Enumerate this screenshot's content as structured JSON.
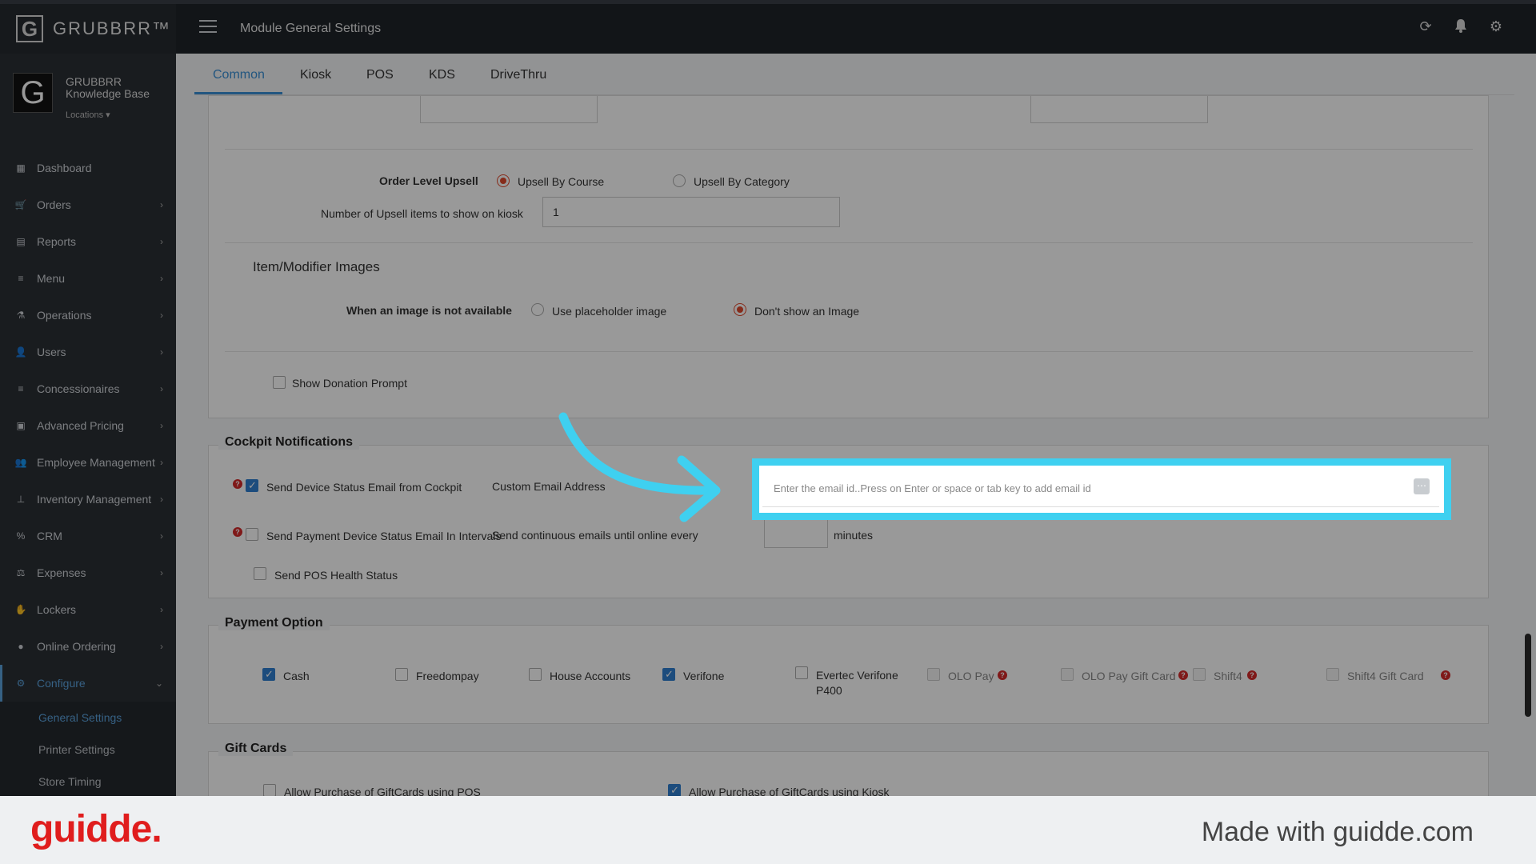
{
  "app": {
    "brand": "GRUBBRR™",
    "logo_letter": "G",
    "page_title": "Module General Settings"
  },
  "topbar_icons": [
    "refresh-icon",
    "bell-icon",
    "gear-icon"
  ],
  "profile": {
    "name": "GRUBBRR Knowledge Base",
    "locations_label": "Locations"
  },
  "sidebar": {
    "items": [
      {
        "label": "Dashboard",
        "icon": "dashboard-icon"
      },
      {
        "label": "Orders",
        "icon": "cart-icon"
      },
      {
        "label": "Reports",
        "icon": "report-icon"
      },
      {
        "label": "Menu",
        "icon": "list-icon"
      },
      {
        "label": "Operations",
        "icon": "flask-icon"
      },
      {
        "label": "Users",
        "icon": "user-add-icon"
      },
      {
        "label": "Concessionaires",
        "icon": "list-icon"
      },
      {
        "label": "Advanced Pricing",
        "icon": "money-icon"
      },
      {
        "label": "Employee Management",
        "icon": "users-icon"
      },
      {
        "label": "Inventory Management",
        "icon": "sitemap-icon"
      },
      {
        "label": "CRM",
        "icon": "percent-icon"
      },
      {
        "label": "Expenses",
        "icon": "scale-icon"
      },
      {
        "label": "Lockers",
        "icon": "lockers-icon"
      },
      {
        "label": "Online Ordering",
        "icon": "globe-icon"
      },
      {
        "label": "Configure",
        "icon": "cog-icon"
      }
    ],
    "sub_items": [
      "General Settings",
      "Printer Settings",
      "Store Timing"
    ]
  },
  "tabs": [
    "Common",
    "Kiosk",
    "POS",
    "KDS",
    "DriveThru"
  ],
  "upsell": {
    "label": "Order Level Upsell",
    "option1": "Upsell By Course",
    "option2": "Upsell By Category",
    "count_label": "Number of Upsell items to show on kiosk",
    "count_value": "1"
  },
  "images": {
    "title": "Item/Modifier Images",
    "label": "When an image is not available",
    "option1": "Use placeholder image",
    "option2": "Don't show an Image"
  },
  "donation": {
    "label": "Show Donation Prompt"
  },
  "cockpit": {
    "title": "Cockpit Notifications",
    "send_device_status": "Send Device Status Email from Cockpit",
    "custom_email_label": "Custom Email Address",
    "email_placeholder": "Enter the email id..Press on Enter or space or tab key to add email id",
    "send_payment_status": "Send Payment Device Status Email In Intervals",
    "continuous_label": "Send continuous emails until online every",
    "minutes_label": "minutes",
    "pos_health": "Send POS Health Status"
  },
  "payment": {
    "title": "Payment Option",
    "options": [
      "Cash",
      "Freedompay",
      "House Accounts",
      "Verifone",
      "Evertec Verifone P400",
      "OLO Pay",
      "OLO Pay Gift Card",
      "Shift4",
      "Shift4 Gift Card"
    ]
  },
  "gift_cards": {
    "title": "Gift Cards",
    "pos_label": "Allow Purchase of GiftCards using POS",
    "kiosk_label": "Allow Purchase of GiftCards using Kiosk"
  },
  "footer": {
    "logo": "guidde.",
    "made_with": "Made with guidde.com"
  },
  "colors": {
    "accent": "#3a8fd6",
    "highlight": "#3fd0f0",
    "radio_selected": "#e0482c",
    "brand_red": "#e01d1d"
  }
}
